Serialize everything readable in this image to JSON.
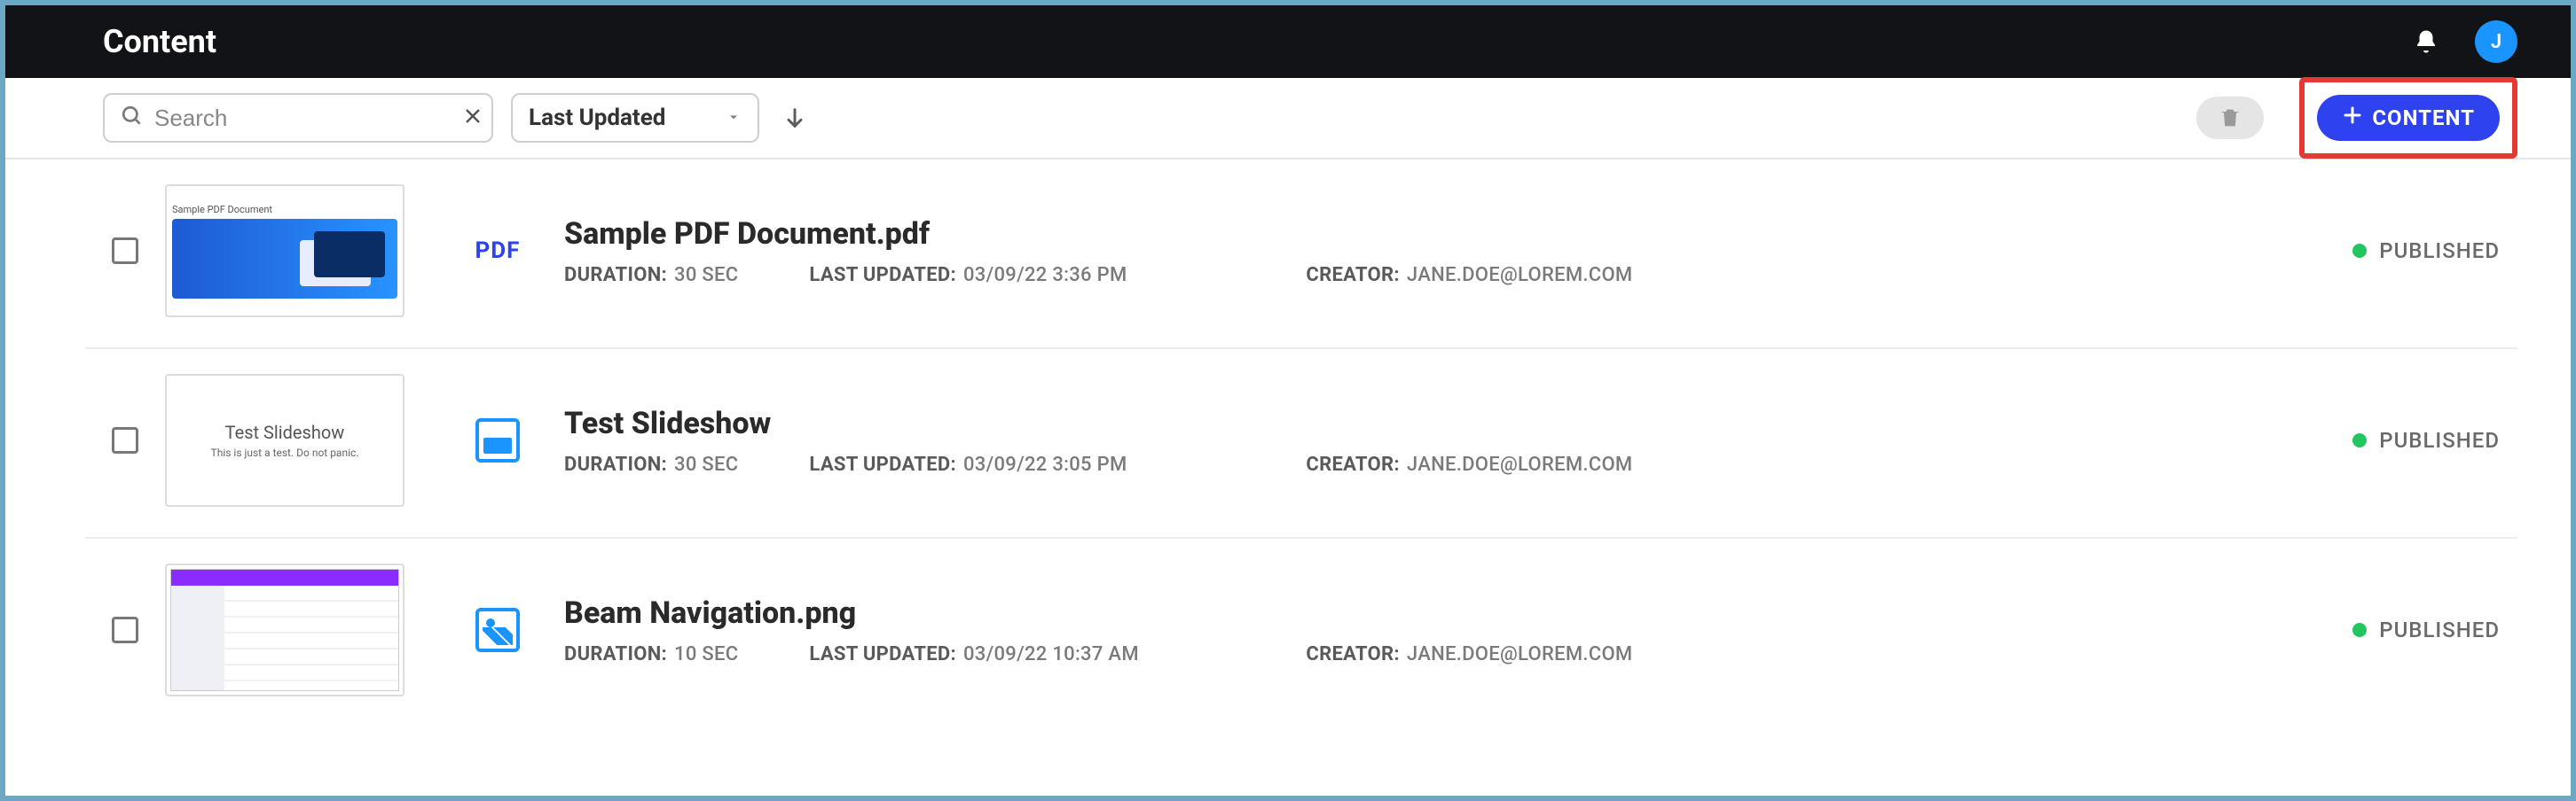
{
  "header": {
    "title": "Content",
    "avatar_initial": "J"
  },
  "toolbar": {
    "search_placeholder": "Search",
    "sort_label": "Last Updated",
    "add_content_label": "CONTENT"
  },
  "meta_labels": {
    "duration": "DURATION:",
    "last_updated": "LAST UPDATED:",
    "creator": "CREATOR:"
  },
  "status_labels": {
    "published": "PUBLISHED"
  },
  "items": [
    {
      "thumb_kind": "pdf",
      "thumb_title": "Sample PDF Document",
      "type_label": "PDF",
      "title": "Sample PDF Document.pdf",
      "duration": "30 SEC",
      "last_updated": "03/09/22 3:36 PM",
      "creator": "JANE.DOE@LOREM.COM",
      "status": "PUBLISHED"
    },
    {
      "thumb_kind": "slide",
      "thumb_title": "Test Slideshow",
      "thumb_sub": "This is just a test. Do not panic.",
      "type_label": "SLIDESHOW",
      "title": "Test Slideshow",
      "duration": "30 SEC",
      "last_updated": "03/09/22 3:05 PM",
      "creator": "JANE.DOE@LOREM.COM",
      "status": "PUBLISHED"
    },
    {
      "thumb_kind": "image",
      "type_label": "IMAGE",
      "title": "Beam Navigation.png",
      "duration": "10 SEC",
      "last_updated": "03/09/22 10:37 AM",
      "creator": "JANE.DOE@LOREM.COM",
      "status": "PUBLISHED"
    }
  ]
}
